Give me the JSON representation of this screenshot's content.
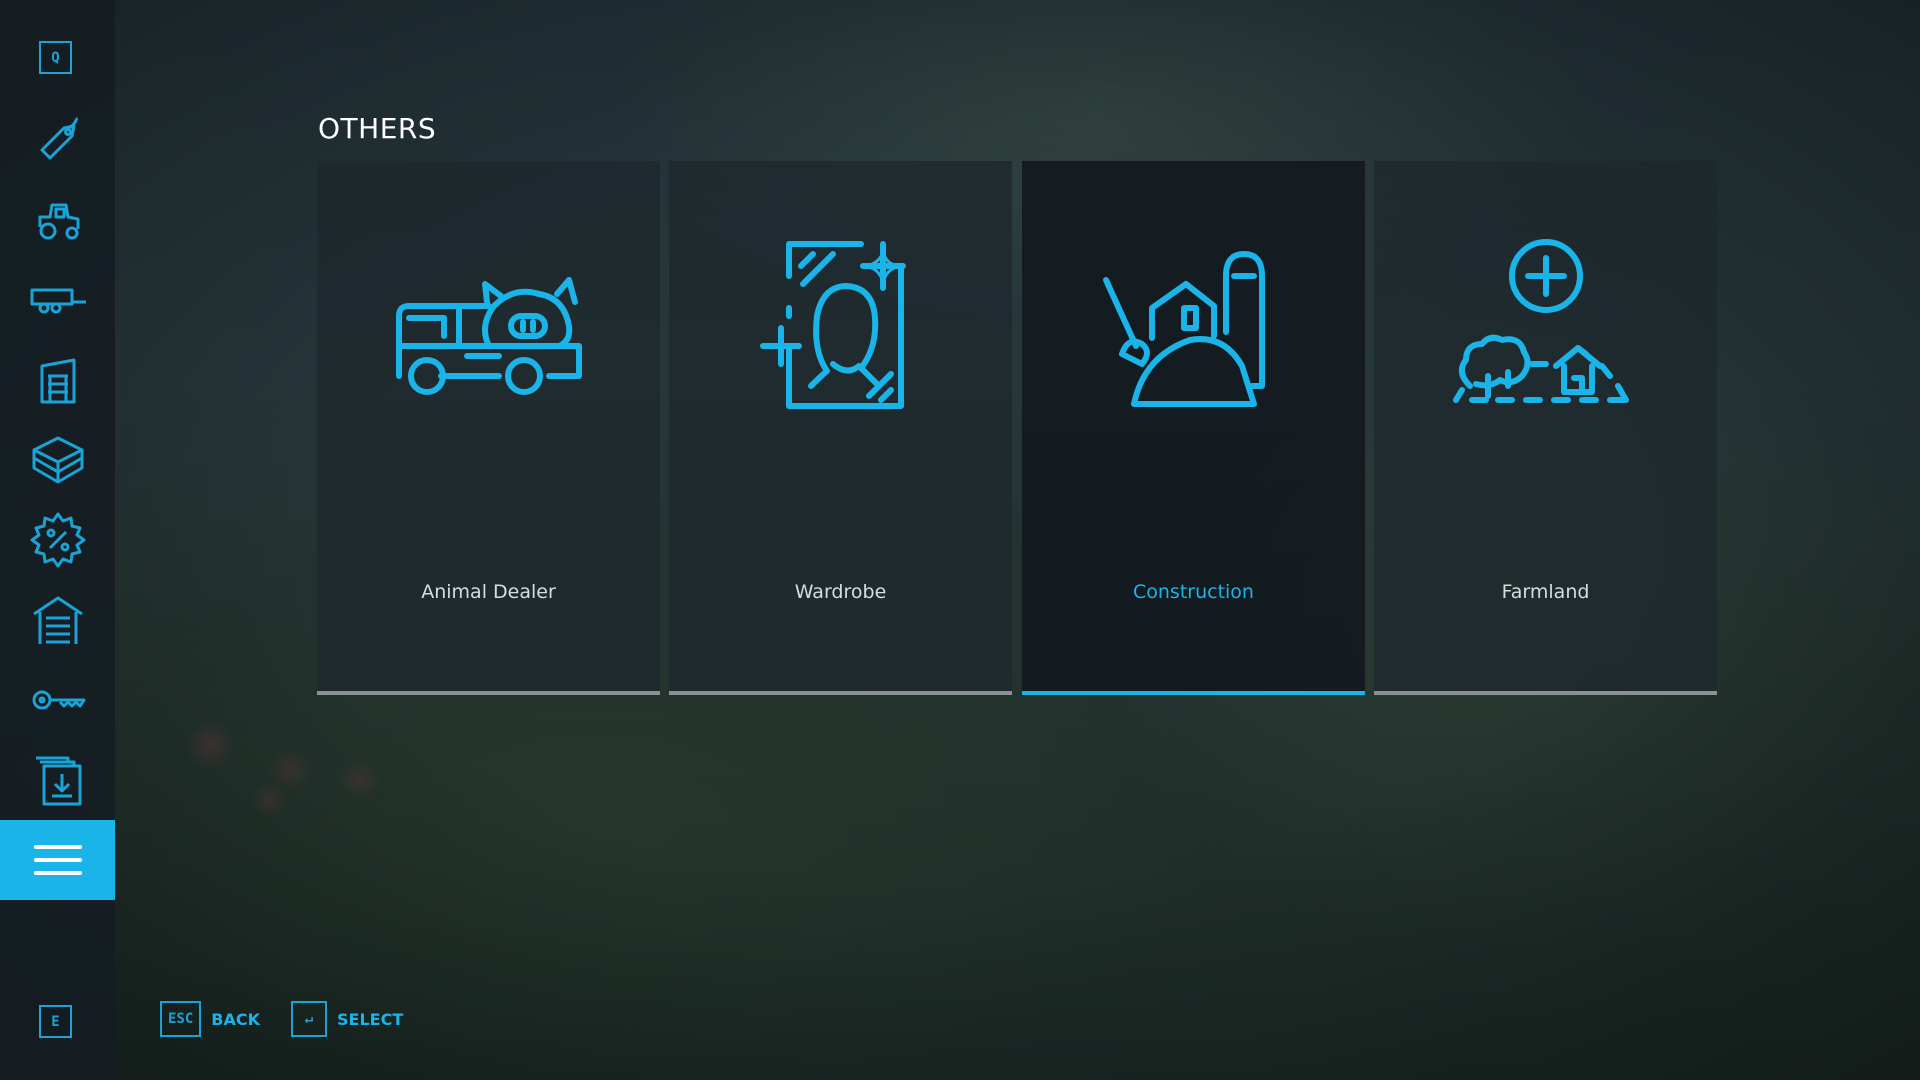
{
  "theme": {
    "accent": "#1ab4e8",
    "sidebar_bg": "#141c22",
    "card_bg": "#1e282d",
    "card_selected_bg": "#12181e",
    "bar_inactive": "#8a9094"
  },
  "sidebar": {
    "top_key": "Q",
    "bottom_key": "E",
    "items": [
      {
        "icon": "price-tag-icon",
        "active": false
      },
      {
        "icon": "tractor-icon",
        "active": false
      },
      {
        "icon": "trailer-icon",
        "active": false
      },
      {
        "icon": "silo-building-icon",
        "active": false
      },
      {
        "icon": "box-package-icon",
        "active": false
      },
      {
        "icon": "sale-percent-icon",
        "active": false
      },
      {
        "icon": "shed-icon",
        "active": false
      },
      {
        "icon": "key-icon",
        "active": false
      },
      {
        "icon": "downloads-icon",
        "active": false
      },
      {
        "icon": "menu-hamburger-icon",
        "active": true
      }
    ]
  },
  "main": {
    "title": "OTHERS",
    "cards": [
      {
        "label": "Animal Dealer",
        "icon": "animal-truck-icon",
        "selected": false
      },
      {
        "label": "Wardrobe",
        "icon": "wardrobe-portrait-icon",
        "selected": false
      },
      {
        "label": "Construction",
        "icon": "construction-barn-icon",
        "selected": true
      },
      {
        "label": "Farmland",
        "icon": "farmland-add-icon",
        "selected": false
      }
    ]
  },
  "footer": {
    "back": {
      "key": "ESC",
      "label": "BACK"
    },
    "select": {
      "key": "↵",
      "label": "SELECT"
    }
  }
}
